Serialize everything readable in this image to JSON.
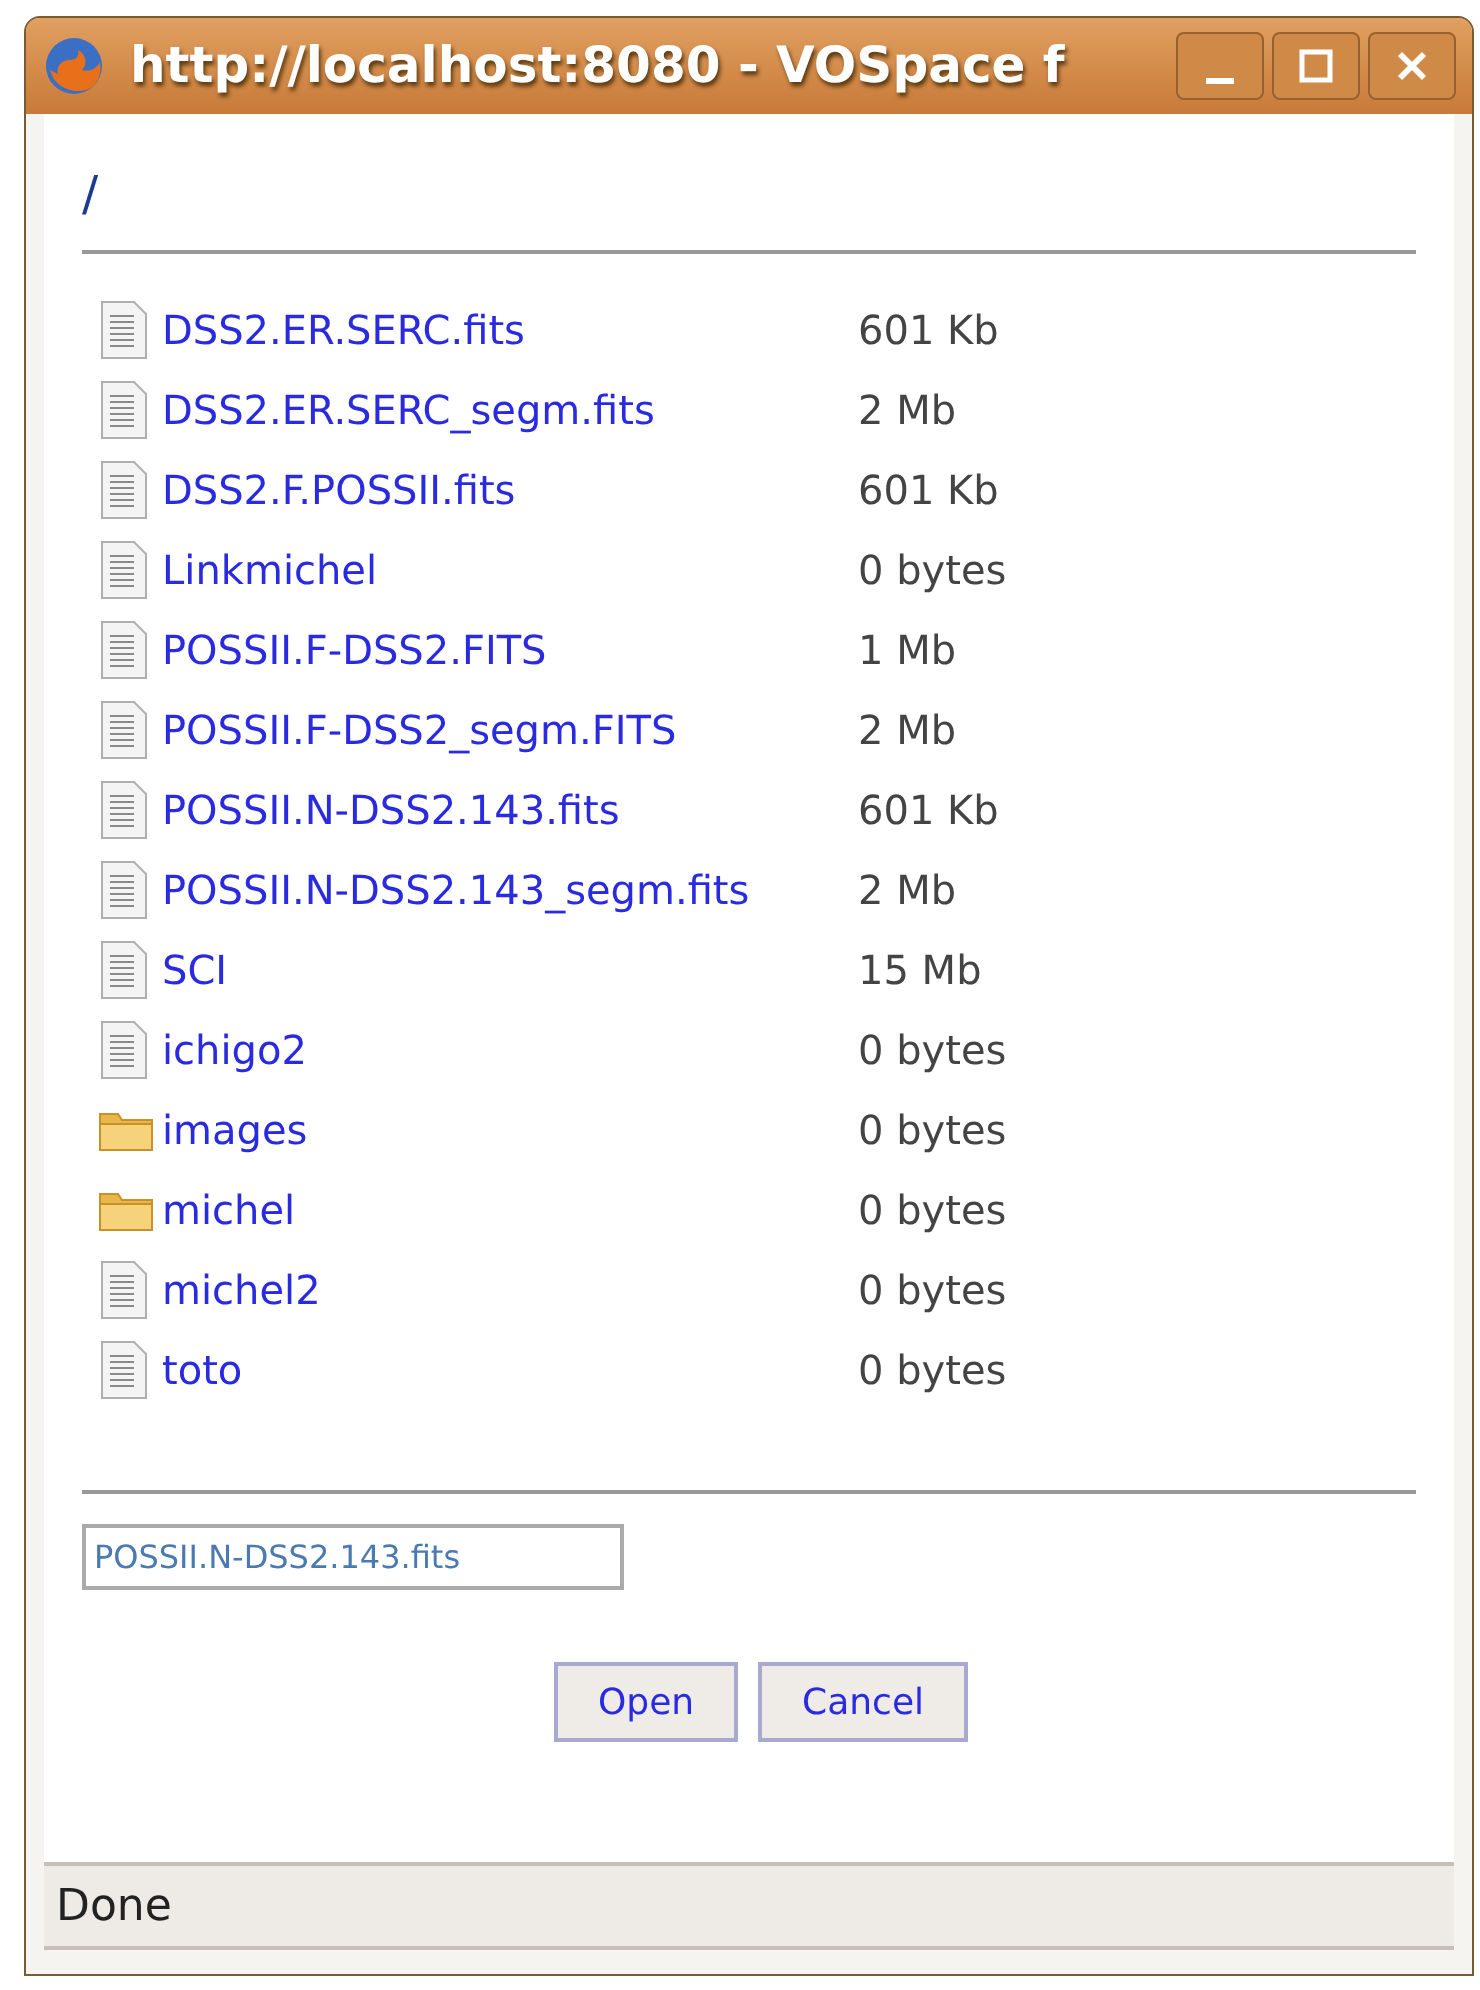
{
  "window": {
    "title": "http://localhost:8080 - VOSpace f"
  },
  "path": "/",
  "files": [
    {
      "kind": "file",
      "name": "DSS2.ER.SERC.fits",
      "size": "601 Kb"
    },
    {
      "kind": "file",
      "name": "DSS2.ER.SERC_segm.fits",
      "size": "2 Mb"
    },
    {
      "kind": "file",
      "name": "DSS2.F.POSSII.fits",
      "size": "601 Kb"
    },
    {
      "kind": "file",
      "name": "Linkmichel",
      "size": "0 bytes"
    },
    {
      "kind": "file",
      "name": "POSSII.F-DSS2.FITS",
      "size": "1 Mb"
    },
    {
      "kind": "file",
      "name": "POSSII.F-DSS2_segm.FITS",
      "size": "2 Mb"
    },
    {
      "kind": "file",
      "name": "POSSII.N-DSS2.143.fits",
      "size": "601 Kb"
    },
    {
      "kind": "file",
      "name": "POSSII.N-DSS2.143_segm.fits",
      "size": "2 Mb"
    },
    {
      "kind": "file",
      "name": "SCI",
      "size": "15 Mb"
    },
    {
      "kind": "file",
      "name": "ichigo2",
      "size": "0 bytes"
    },
    {
      "kind": "folder",
      "name": "images",
      "size": "0 bytes"
    },
    {
      "kind": "folder",
      "name": "michel",
      "size": "0 bytes"
    },
    {
      "kind": "file",
      "name": "michel2",
      "size": "0 bytes"
    },
    {
      "kind": "file",
      "name": "toto",
      "size": "0 bytes"
    }
  ],
  "filename_field": {
    "value": "POSSII.N-DSS2.143.fits"
  },
  "buttons": [
    "Open",
    "Cancel"
  ],
  "status_bar": "Done"
}
